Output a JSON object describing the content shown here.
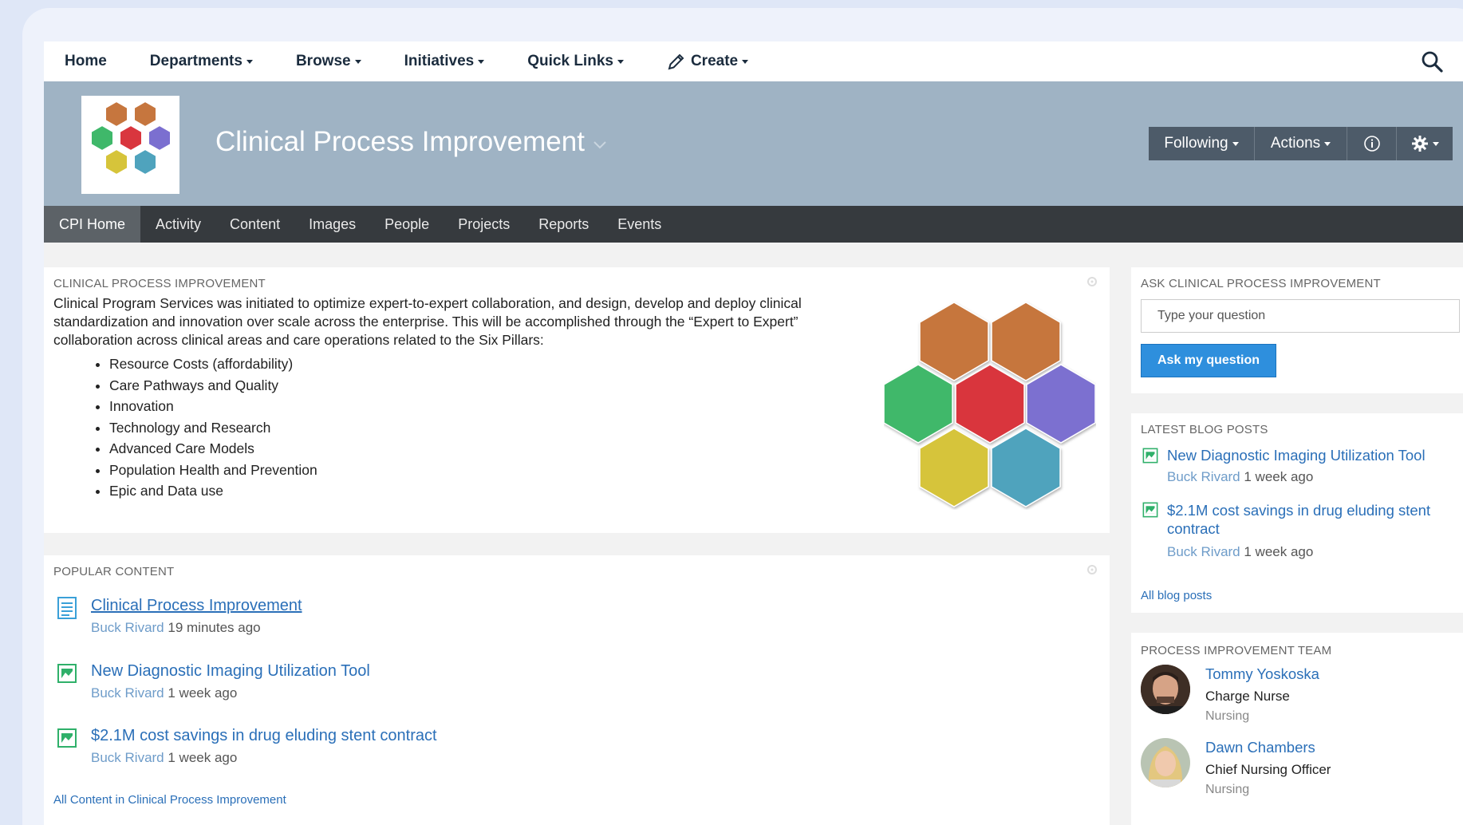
{
  "nav": {
    "items": [
      {
        "label": "Home",
        "caret": false
      },
      {
        "label": "Departments",
        "caret": true
      },
      {
        "label": "Browse",
        "caret": true
      },
      {
        "label": "Initiatives",
        "caret": true
      },
      {
        "label": "Quick Links",
        "caret": true
      },
      {
        "label": "Create",
        "caret": true
      }
    ]
  },
  "place": {
    "title": "Clinical Process Improvement",
    "following_label": "Following",
    "actions_label": "Actions"
  },
  "tabs": [
    "CPI Home",
    "Activity",
    "Content",
    "Images",
    "People",
    "Projects",
    "Reports",
    "Events"
  ],
  "overview": {
    "heading": "CLINICAL PROCESS IMPROVEMENT",
    "description": "Clinical Program Services was initiated to optimize expert-to-expert collaboration, and design, develop and deploy clinical standardization and innovation over scale across the enterprise. This will be accomplished through the “Expert to Expert” collaboration across clinical areas and care operations related to the Six Pillars:",
    "pillars": [
      "Resource Costs (affordability)",
      "Care Pathways and Quality",
      "Innovation",
      "Technology and Research",
      "Advanced Care Models",
      "Population Health and Prevention",
      "Epic and Data use"
    ]
  },
  "popular": {
    "heading": "POPULAR CONTENT",
    "items": [
      {
        "title": "Clinical Process Improvement",
        "author": "Buck Rivard",
        "time": "19 minutes ago",
        "icon": "document-icon"
      },
      {
        "title": "New Diagnostic Imaging Utilization Tool",
        "author": "Buck Rivard",
        "time": "1 week ago",
        "icon": "blog-post-icon"
      },
      {
        "title": "$2.1M cost savings in drug eluding stent contract",
        "author": "Buck Rivard",
        "time": "1 week ago",
        "icon": "blog-post-icon"
      }
    ],
    "all_link": "All Content in Clinical Process Improvement"
  },
  "ask": {
    "heading": "ASK CLINICAL PROCESS IMPROVEMENT",
    "placeholder": "Type your question",
    "button": "Ask my question"
  },
  "blog": {
    "heading": "LATEST BLOG POSTS",
    "posts": [
      {
        "title": "New Diagnostic Imaging Utilization Tool",
        "author": "Buck Rivard",
        "time": "1 week ago"
      },
      {
        "title_line1": "$2.1M cost savings in drug eluding stent",
        "title_line2": "contract",
        "author": "Buck Rivard",
        "time": "1 week ago"
      }
    ],
    "all_link": "All blog posts"
  },
  "team": {
    "heading": "PROCESS IMPROVEMENT TEAM",
    "members": [
      {
        "name": "Tommy Yoskoska",
        "role": "Charge Nurse",
        "dept": "Nursing"
      },
      {
        "name": "Dawn Chambers",
        "role": "Chief Nursing Officer",
        "dept": "Nursing"
      }
    ]
  },
  "colors": {
    "banner": "#9fb3c4",
    "tabbar": "#363a3e",
    "link": "#2a6fb8",
    "button": "#2e8fdd",
    "hex_orange": "#c6763e",
    "hex_green": "#3fb86a",
    "hex_red": "#d9363e",
    "hex_purple": "#7b6fd0",
    "hex_yellow": "#d6c43a",
    "hex_blue": "#4fa3bd"
  }
}
